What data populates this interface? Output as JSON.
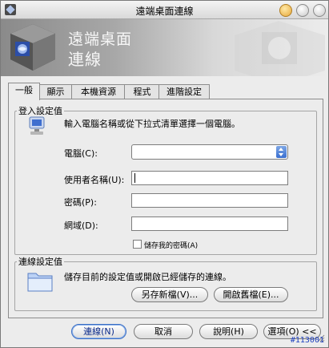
{
  "window": {
    "title": "遠端桌面連線"
  },
  "banner": {
    "title_line1": "遠端桌面",
    "title_line2": "連線"
  },
  "tabs": [
    {
      "label": "一般",
      "active": true
    },
    {
      "label": "顯示",
      "active": false
    },
    {
      "label": "本機資源",
      "active": false
    },
    {
      "label": "程式",
      "active": false
    },
    {
      "label": "進階設定",
      "active": false
    }
  ],
  "login_settings": {
    "group_label": "登入設定值",
    "instruction": "輸入電腦名稱或從下拉式清單選擇一個電腦。",
    "computer_label": "電腦(C):",
    "computer_value": "",
    "username_label": "使用者名稱(U):",
    "username_value": "",
    "password_label": "密碼(P):",
    "password_value": "",
    "domain_label": "網域(D):",
    "domain_value": "",
    "save_password_label": "儲存我的密碼(A)",
    "save_password_checked": false
  },
  "connection_settings": {
    "group_label": "連線設定值",
    "instruction": "儲存目前的設定值或開啟已經儲存的連線。",
    "save_as_button": "另存新檔(V)...",
    "open_button": "開啟舊檔(E)..."
  },
  "buttons": {
    "connect": "連線(N)",
    "cancel": "取消",
    "help": "說明(H)",
    "options": "選項(O) <<"
  },
  "footer": {
    "ref_label": "#113001"
  },
  "colors": {
    "accent": "#3b6fc4",
    "window_bg": "#ececec",
    "combo_arrow": "#3a6fd0"
  },
  "icons": [
    "app-icon",
    "computer-icon",
    "folder-icon",
    "dropdown-arrow-icon",
    "minimize-icon",
    "maximize-icon",
    "close-icon"
  ]
}
